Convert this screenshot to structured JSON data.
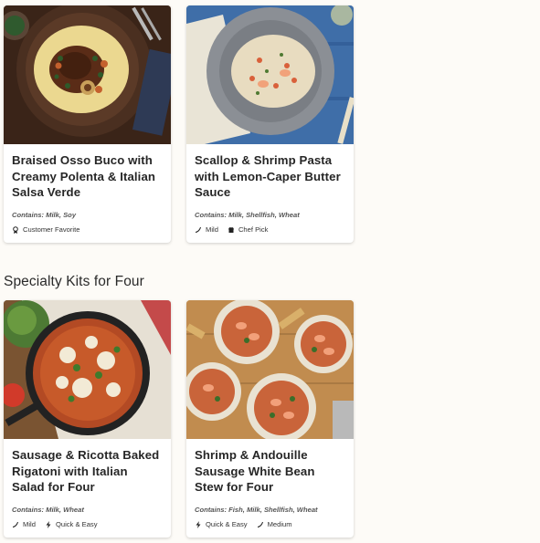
{
  "section": {
    "title": "Specialty Kits for Four"
  },
  "cards": [
    {
      "title": "Braised Osso Buco with Creamy Polenta & Italian Salsa Verde",
      "image_alt": "Osso buco on polenta",
      "contains": "Contains: Milk, Soy",
      "tags": [
        {
          "icon": "ribbon-icon",
          "label": "Customer Favorite"
        }
      ]
    },
    {
      "title": "Scallop & Shrimp Pasta with Lemon-Caper Butter Sauce",
      "image_alt": "Shrimp pasta in a grey bowl",
      "contains": "Contains: Milk, Shellfish, Wheat",
      "tags": [
        {
          "icon": "chili-pepper-icon",
          "label": "Mild"
        },
        {
          "icon": "chef-hat-icon",
          "label": "Chef Pick"
        }
      ]
    },
    {
      "title": "Sausage & Ricotta Baked Rigatoni with Italian Salad for Four",
      "image_alt": "Baked rigatoni in a cast iron skillet",
      "contains": "Contains: Milk, Wheat",
      "tags": [
        {
          "icon": "chili-pepper-icon",
          "label": "Mild"
        },
        {
          "icon": "lightning-icon",
          "label": "Quick & Easy"
        }
      ]
    },
    {
      "title": "Shrimp & Andouille Sausage White Bean Stew for Four",
      "image_alt": "Bowls of shrimp and sausage stew",
      "contains": "Contains: Fish, Milk, Shellfish, Wheat",
      "tags": [
        {
          "icon": "lightning-icon",
          "label": "Quick & Easy"
        },
        {
          "icon": "chili-pepper-icon",
          "label": "Medium"
        }
      ]
    }
  ]
}
